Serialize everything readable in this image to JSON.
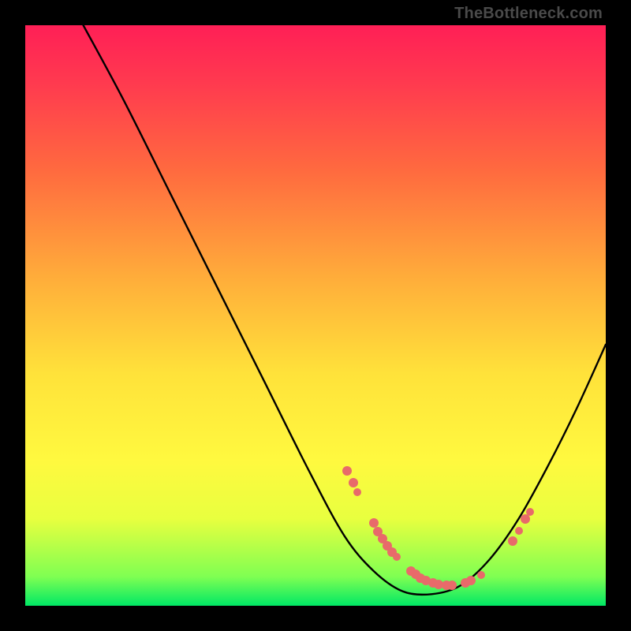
{
  "attribution": "TheBottleneck.com",
  "chart_data": {
    "type": "line",
    "title": "",
    "xlabel": "",
    "ylabel": "",
    "xlim": [
      0,
      100
    ],
    "ylim": [
      0,
      100
    ],
    "curve": [
      {
        "x": 10,
        "y": 100
      },
      {
        "x": 17,
        "y": 87
      },
      {
        "x": 25,
        "y": 71
      },
      {
        "x": 33,
        "y": 55
      },
      {
        "x": 41,
        "y": 39
      },
      {
        "x": 49,
        "y": 23
      },
      {
        "x": 55,
        "y": 12
      },
      {
        "x": 60,
        "y": 6
      },
      {
        "x": 65,
        "y": 2.5
      },
      {
        "x": 70,
        "y": 2
      },
      {
        "x": 75,
        "y": 3.5
      },
      {
        "x": 80,
        "y": 8
      },
      {
        "x": 85,
        "y": 15
      },
      {
        "x": 90,
        "y": 24
      },
      {
        "x": 95,
        "y": 34
      },
      {
        "x": 100,
        "y": 45
      }
    ],
    "markers": [
      {
        "x": 55.5,
        "y": 23.3,
        "r": 6
      },
      {
        "x": 56.5,
        "y": 21.2,
        "r": 6
      },
      {
        "x": 57.2,
        "y": 19.6,
        "r": 5
      },
      {
        "x": 60.0,
        "y": 14.2,
        "r": 6
      },
      {
        "x": 60.8,
        "y": 12.8,
        "r": 6
      },
      {
        "x": 61.5,
        "y": 11.6,
        "r": 6
      },
      {
        "x": 62.4,
        "y": 10.3,
        "r": 6
      },
      {
        "x": 63.2,
        "y": 9.3,
        "r": 6
      },
      {
        "x": 64.0,
        "y": 8.4,
        "r": 5
      },
      {
        "x": 66.5,
        "y": 6.0,
        "r": 6
      },
      {
        "x": 67.3,
        "y": 5.4,
        "r": 6
      },
      {
        "x": 68.1,
        "y": 4.8,
        "r": 6
      },
      {
        "x": 69.0,
        "y": 4.3,
        "r": 6
      },
      {
        "x": 70.3,
        "y": 3.9,
        "r": 6
      },
      {
        "x": 71.2,
        "y": 3.7,
        "r": 6
      },
      {
        "x": 72.5,
        "y": 3.6,
        "r": 6
      },
      {
        "x": 73.5,
        "y": 3.6,
        "r": 6
      },
      {
        "x": 75.8,
        "y": 4.0,
        "r": 6
      },
      {
        "x": 76.8,
        "y": 4.4,
        "r": 6
      },
      {
        "x": 78.5,
        "y": 5.3,
        "r": 5
      },
      {
        "x": 84.0,
        "y": 11.2,
        "r": 6
      },
      {
        "x": 85.0,
        "y": 12.9,
        "r": 5
      },
      {
        "x": 86.2,
        "y": 15.0,
        "r": 6
      },
      {
        "x": 86.9,
        "y": 16.2,
        "r": 5
      }
    ]
  }
}
